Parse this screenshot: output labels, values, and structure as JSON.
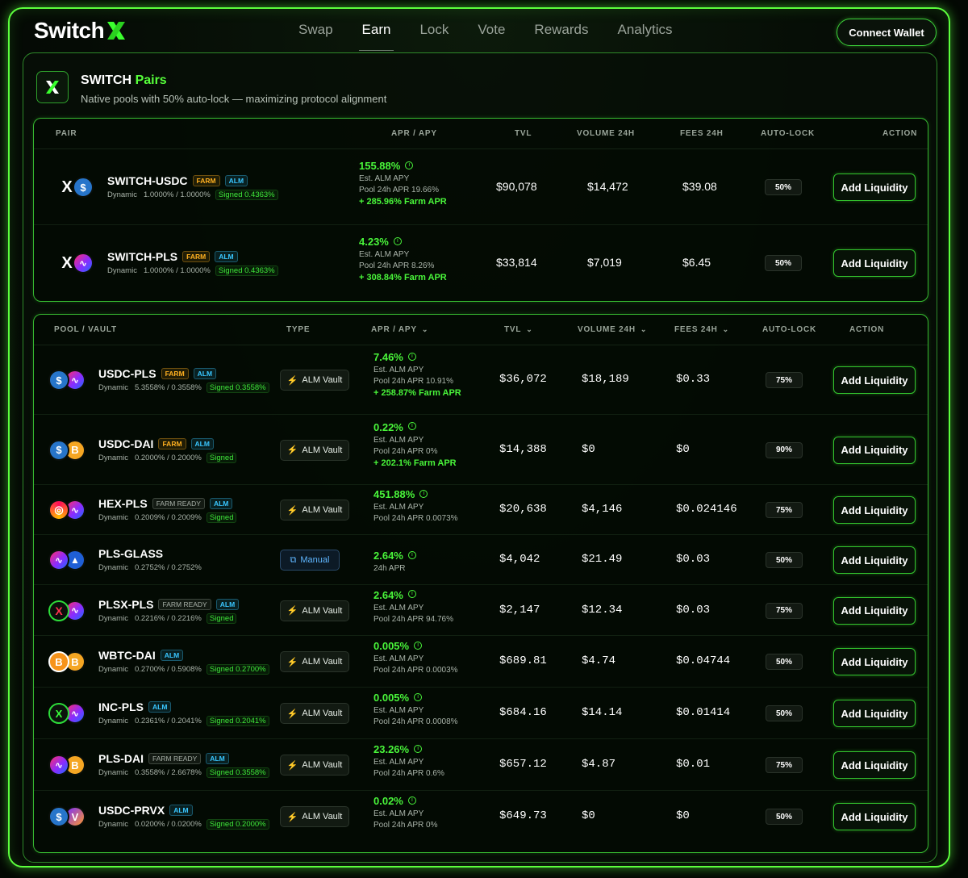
{
  "header": {
    "logo_text": "Switch",
    "nav": [
      "Swap",
      "Earn",
      "Lock",
      "Vote",
      "Rewards",
      "Analytics"
    ],
    "active_nav": "Earn",
    "connect_label": "Connect Wallet"
  },
  "section": {
    "title_main": "SWITCH",
    "title_accent": "Pairs",
    "subtitle": "Native pools with 50% auto-lock — maximizing protocol alignment"
  },
  "switch_table": {
    "headers": {
      "pair": "PAIR",
      "apr": "APR / APY",
      "tvl": "TVL",
      "volume": "VOLUME 24H",
      "fees": "FEES 24H",
      "autolock": "AUTO-LOCK",
      "action": "ACTION"
    },
    "rows": [
      {
        "icons": [
          "switch",
          "usdc"
        ],
        "name": "SWITCH-USDC",
        "badges": [
          "FARM",
          "ALM"
        ],
        "dyn": "Dynamic",
        "fee": "1.0000% / 1.0000%",
        "signed": "Signed 0.4363%",
        "apr": "155.88%",
        "l1": "Est. ALM APY",
        "l2": "Pool 24h APR 19.66%",
        "farm": "+ 285.96% Farm APR",
        "tvl": "$90,078",
        "volume": "$14,472",
        "fees": "$39.08",
        "lock": "50%",
        "action": "Add Liquidity"
      },
      {
        "icons": [
          "switch",
          "pls"
        ],
        "name": "SWITCH-PLS",
        "badges": [
          "FARM",
          "ALM"
        ],
        "dyn": "Dynamic",
        "fee": "1.0000% / 1.0000%",
        "signed": "Signed 0.4363%",
        "apr": "4.23%",
        "l1": "Est. ALM APY",
        "l2": "Pool 24h APR 8.26%",
        "farm": "+ 308.84% Farm APR",
        "tvl": "$33,814",
        "volume": "$7,019",
        "fees": "$6.45",
        "lock": "50%",
        "action": "Add Liquidity"
      }
    ]
  },
  "pool_table": {
    "headers": {
      "pool": "POOL / VAULT",
      "type": "TYPE",
      "apr": "APR / APY",
      "tvl": "TVL",
      "volume": "VOLUME 24H",
      "fees": "FEES 24H",
      "autolock": "AUTO-LOCK",
      "action": "ACTION"
    },
    "rows": [
      {
        "icons": [
          "usdc",
          "pls"
        ],
        "name": "USDC-PLS",
        "badges": [
          "FARM",
          "ALM"
        ],
        "dyn": "Dynamic",
        "fee": "5.3558% / 0.3558%",
        "signed": "Signed 0.3558%",
        "type": "ALM Vault",
        "apr": "7.46%",
        "l1": "Est. ALM APY",
        "l2": "Pool 24h APR 10.91%",
        "farm": "+ 258.87% Farm APR",
        "tvl": "$36,072",
        "volume": "$18,189",
        "fees": "$0.33",
        "lock": "75%",
        "action": "Add Liquidity"
      },
      {
        "icons": [
          "usdc",
          "dai"
        ],
        "name": "USDC-DAI",
        "badges": [
          "FARM",
          "ALM"
        ],
        "dyn": "Dynamic",
        "fee": "0.2000% / 0.2000%",
        "signed": "Signed",
        "type": "ALM Vault",
        "apr": "0.22%",
        "l1": "Est. ALM APY",
        "l2": "Pool 24h APR 0%",
        "farm": "+ 202.1% Farm APR",
        "tvl": "$14,388",
        "volume": "$0",
        "fees": "$0",
        "lock": "90%",
        "action": "Add Liquidity"
      },
      {
        "icons": [
          "hex",
          "pls"
        ],
        "name": "HEX-PLS",
        "badges": [
          "FARM READY",
          "ALM"
        ],
        "dyn": "Dynamic",
        "fee": "0.2009% / 0.2009%",
        "signed": "Signed",
        "type": "ALM Vault",
        "apr": "451.88%",
        "l1": "Est. ALM APY",
        "l2": "Pool 24h APR 0.0073%",
        "farm": "",
        "tvl": "$20,638",
        "volume": "$4,146",
        "fees": "$0.024146",
        "lock": "75%",
        "action": "Add Liquidity"
      },
      {
        "icons": [
          "pls",
          "glass"
        ],
        "name": "PLS-GLASS",
        "badges": [],
        "dyn": "Dynamic",
        "fee": "0.2752% / 0.2752%",
        "signed": "",
        "type": "Manual",
        "apr": "2.64%",
        "l1": "24h APR",
        "l2": "",
        "farm": "",
        "tvl": "$4,042",
        "volume": "$21.49",
        "fees": "$0.03",
        "lock": "50%",
        "action": "Add Liquidity"
      },
      {
        "icons": [
          "plsx",
          "pls"
        ],
        "name": "PLSX-PLS",
        "badges": [
          "FARM READY",
          "ALM"
        ],
        "dyn": "Dynamic",
        "fee": "0.2216% / 0.2216%",
        "signed": "Signed",
        "type": "ALM Vault",
        "apr": "2.64%",
        "l1": "Est. ALM APY",
        "l2": "Pool 24h APR 94.76%",
        "farm": "",
        "tvl": "$2,147",
        "volume": "$12.34",
        "fees": "$0.03",
        "lock": "75%",
        "action": "Add Liquidity"
      },
      {
        "icons": [
          "wbtc",
          "dai"
        ],
        "name": "WBTC-DAI",
        "badges": [
          "ALM"
        ],
        "dyn": "Dynamic",
        "fee": "0.2700% / 0.5908%",
        "signed": "Signed 0.2700%",
        "type": "ALM Vault",
        "apr": "0.005%",
        "l1": "Est. ALM APY",
        "l2": "Pool 24h APR 0.0003%",
        "farm": "",
        "tvl": "$689.81",
        "volume": "$4.74",
        "fees": "$0.04744",
        "lock": "50%",
        "action": "Add Liquidity"
      },
      {
        "icons": [
          "inc",
          "pls"
        ],
        "name": "INC-PLS",
        "badges": [
          "ALM"
        ],
        "dyn": "Dynamic",
        "fee": "0.2361% / 0.2041%",
        "signed": "Signed 0.2041%",
        "type": "ALM Vault",
        "apr": "0.005%",
        "l1": "Est. ALM APY",
        "l2": "Pool 24h APR 0.0008%",
        "farm": "",
        "tvl": "$684.16",
        "volume": "$14.14",
        "fees": "$0.01414",
        "lock": "50%",
        "action": "Add Liquidity"
      },
      {
        "icons": [
          "pls",
          "dai"
        ],
        "name": "PLS-DAI",
        "badges": [
          "FARM READY",
          "ALM"
        ],
        "dyn": "Dynamic",
        "fee": "0.3558% / 2.6678%",
        "signed": "Signed 0.3558%",
        "type": "ALM Vault",
        "apr": "23.26%",
        "l1": "Est. ALM APY",
        "l2": "Pool 24h APR 0.6%",
        "farm": "",
        "tvl": "$657.12",
        "volume": "$4.87",
        "fees": "$0.01",
        "lock": "75%",
        "action": "Add Liquidity"
      },
      {
        "icons": [
          "usdc",
          "prvx"
        ],
        "name": "USDC-PRVX",
        "badges": [
          "ALM"
        ],
        "dyn": "Dynamic",
        "fee": "0.0200% / 0.0200%",
        "signed": "Signed 0.2000%",
        "type": "ALM Vault",
        "apr": "0.02%",
        "l1": "Est. ALM APY",
        "l2": "Pool 24h APR 0%",
        "farm": "",
        "tvl": "$649.73",
        "volume": "$0",
        "fees": "$0",
        "lock": "50%",
        "action": "Add Liquidity"
      }
    ]
  },
  "colors": {
    "accent": "#56ff3a",
    "farm_badge": "#ffb020",
    "alm_badge": "#39c6ff",
    "background": "#030803"
  }
}
